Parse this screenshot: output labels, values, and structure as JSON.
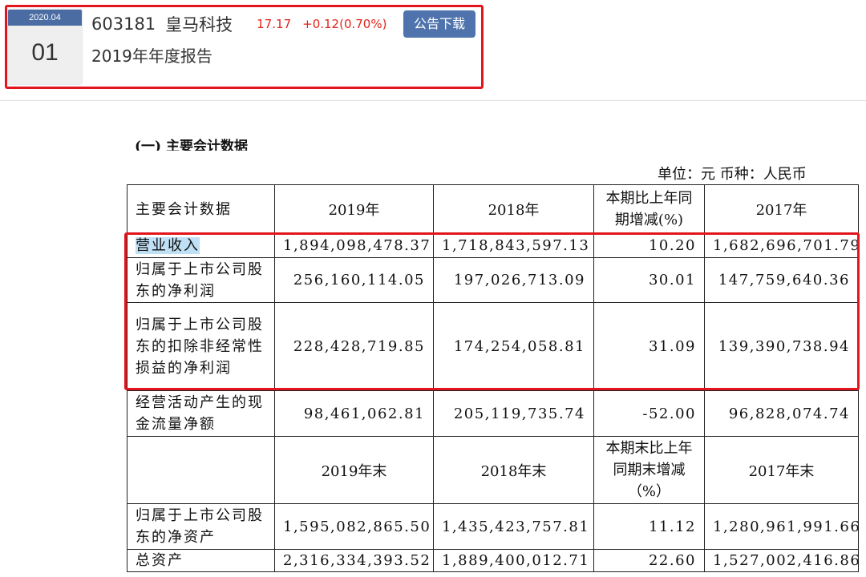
{
  "header": {
    "date_badge": "2020.04",
    "date_day": "01",
    "stock_code": "603181",
    "stock_name": "皇马科技",
    "price": "17.17",
    "change": "+0.12(0.70%)",
    "download_button": "公告下载",
    "report_title": "2019年年度报告",
    "accent_color": "#4f74ad",
    "highlight_color": "#e2151c"
  },
  "document": {
    "section_title": "(一) 主要会计数据",
    "unit_line": "单位：元   币种：人民币",
    "header_row_1": [
      "主要会计数据",
      "2019年",
      "2018年",
      "本期比上年同期增减(%)",
      "2017年"
    ],
    "rows_1": [
      {
        "label": "营业收入",
        "v2019": "1,894,098,478.37",
        "v2018": "1,718,843,597.13",
        "chg": "10.20",
        "v2017": "1,682,696,701.79"
      },
      {
        "label": "归属于上市公司股东的净利润",
        "v2019": "256,160,114.05",
        "v2018": "197,026,713.09",
        "chg": "30.01",
        "v2017": "147,759,640.36"
      },
      {
        "label": "归属于上市公司股东的扣除非经常性损益的净利润",
        "v2019": "228,428,719.85",
        "v2018": "174,254,058.81",
        "chg": "31.09",
        "v2017": "139,390,738.94"
      },
      {
        "label": "经营活动产生的现金流量净额",
        "v2019": "98,461,062.81",
        "v2018": "205,119,735.74",
        "chg": "-52.00",
        "v2017": "96,828,074.74"
      }
    ],
    "header_row_2": [
      "",
      "2019年末",
      "2018年末",
      "本期末比上年同期末增减（%）",
      "2017年末"
    ],
    "rows_2": [
      {
        "label": "归属于上市公司股东的净资产",
        "v2019": "1,595,082,865.50",
        "v2018": "1,435,423,757.81",
        "chg": "11.12",
        "v2017": "1,280,961,991.66"
      },
      {
        "label": "总资产",
        "v2019": "2,316,334,393.52",
        "v2018": "1,889,400,012.71",
        "chg": "22.60",
        "v2017": "1,527,002,416.86"
      }
    ]
  }
}
